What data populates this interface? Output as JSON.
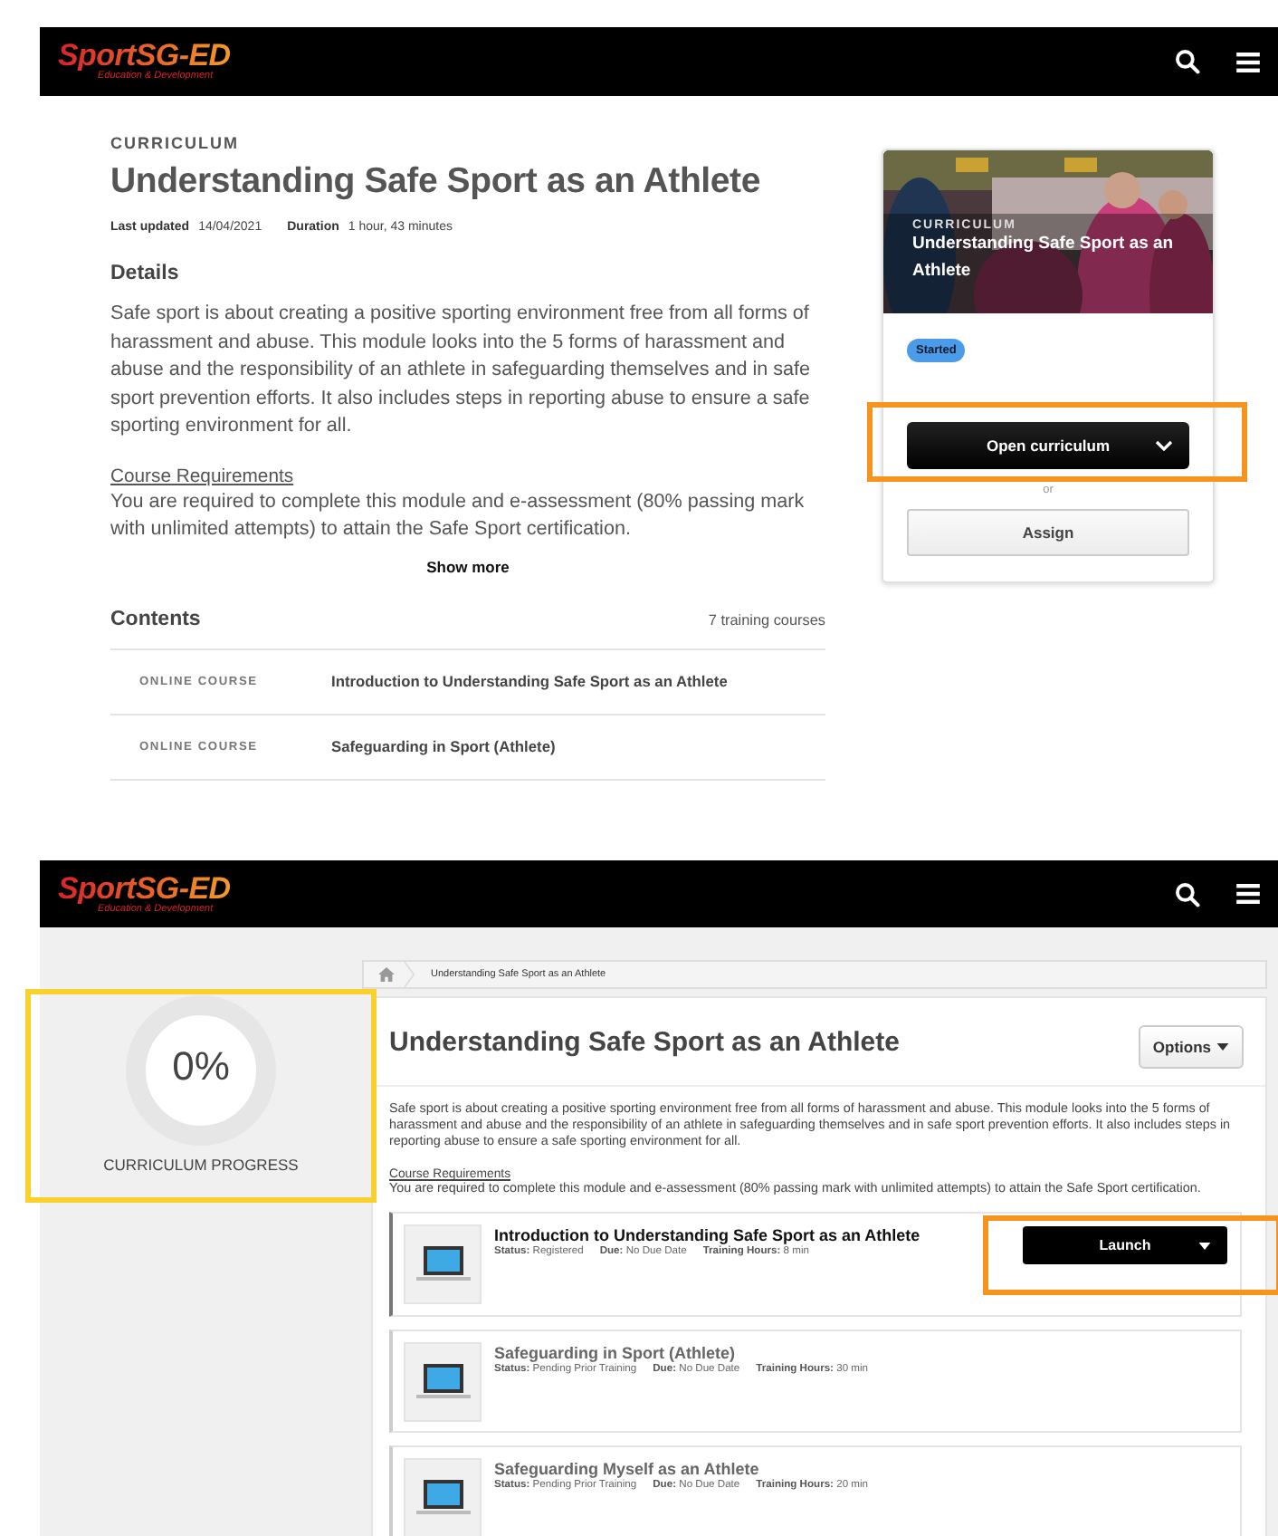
{
  "screens": [
    {
      "kind": "catalog",
      "header": {
        "logo": "SportSG-ED",
        "tagline": "Education & Development"
      },
      "eyebrow": "CURRICULUM",
      "title": "Understanding Safe Sport as an Athlete",
      "meta": [
        {
          "label": "Last updated",
          "value": "14/04/2021"
        },
        {
          "label": "Duration",
          "value": "1 hour, 43 minutes"
        }
      ],
      "details_heading": "Details",
      "description": "Safe sport is about creating a positive sporting environment free from all forms of harassment and abuse. This module looks into the 5 forms of harassment and abuse and the responsibility of an athlete in safeguarding themselves and in safe sport prevention efforts. It also includes steps in reporting abuse to ensure a safe sporting environment for all.",
      "requirements_heading": "Course Requirements",
      "requirements": "You are required to complete this module and e-assessment (80% passing mark with unlimited attempts) to attain the Safe Sport certification.",
      "show_more": "Show more",
      "contents": {
        "heading": "Contents",
        "count": "7 training courses",
        "rows": [
          {
            "type": "ONLINE COURSE",
            "title": "Introduction to Understanding Safe Sport as an Athlete"
          },
          {
            "type": "ONLINE COURSE",
            "title": "Safeguarding in Sport (Athlete)"
          }
        ]
      },
      "card": {
        "eyebrow": "CURRICULUM",
        "title": "Understanding Safe Sport as an Athlete",
        "status": "Started",
        "primary": {
          "label": "Open curriculum",
          "highlight": {
            "color": "#f7941d"
          }
        },
        "separator": "or",
        "secondary": "Assign"
      }
    },
    {
      "kind": "player",
      "header": {
        "logo": "SportSG-ED",
        "tagline": "Education & Development"
      },
      "progress": {
        "value": "0%",
        "label": "CURRICULUM PROGRESS",
        "level": 0,
        "highlight": {
          "color": "#fad02c"
        }
      },
      "breadcrumb": "Understanding Safe Sport as an Athlete",
      "title": "Understanding Safe Sport as an Athlete",
      "options": "Options",
      "description": "Safe sport is about creating a positive sporting environment free from all forms of harassment and abuse. This module looks into the 5 forms of harassment and abuse and the responsibility of an athlete in safeguarding themselves and in safe sport prevention efforts. It also includes steps in reporting abuse to ensure a safe sporting environment for all.",
      "requirements_heading": "Course Requirements",
      "requirements": "You are required to complete this module and e-assessment (80% passing mark with unlimited attempts) to attain the Safe Sport certification.",
      "courses": [
        {
          "title": "Introduction to Understanding Safe Sport as an Athlete",
          "active": true,
          "fields": [
            {
              "label": "Status:",
              "value": "Registered"
            },
            {
              "label": "Due:",
              "value": "No Due Date"
            },
            {
              "label": "Training Hours:",
              "value": "8 min"
            }
          ],
          "action": {
            "label": "Launch",
            "highlight": {
              "color": "#f7941d"
            }
          }
        },
        {
          "title": "Safeguarding in Sport (Athlete)",
          "active": false,
          "fields": [
            {
              "label": "Status:",
              "value": "Pending Prior Training"
            },
            {
              "label": "Due:",
              "value": "No Due Date"
            },
            {
              "label": "Training Hours:",
              "value": "30 min"
            }
          ]
        },
        {
          "title": "Safeguarding Myself as an Athlete",
          "active": false,
          "fields": [
            {
              "label": "Status:",
              "value": "Pending Prior Training"
            },
            {
              "label": "Due:",
              "value": "No Due Date"
            },
            {
              "label": "Training Hours:",
              "value": "20 min"
            }
          ]
        }
      ]
    }
  ]
}
